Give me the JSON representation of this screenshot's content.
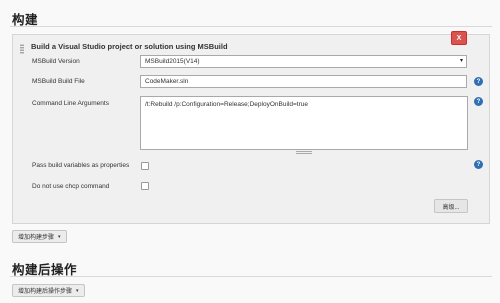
{
  "build_section": {
    "title": "构建"
  },
  "step": {
    "title": "Build a Visual Studio project or solution using MSBuild",
    "close_label": "X",
    "fields": {
      "msbuild_version": {
        "label": "MSBuild Version",
        "value": "MSBuild2015(V14)"
      },
      "build_file": {
        "label": "MSBuild Build File",
        "value": "CodeMaker.sln"
      },
      "command_args": {
        "label": "Command Line Arguments",
        "value": "/t:Rebuild /p:Configuration=Release;DeployOnBuild=true"
      },
      "pass_vars": {
        "label": "Pass build variables as properties",
        "checked": false
      },
      "no_chcp": {
        "label": "Do not use chcp command",
        "checked": false
      }
    },
    "advanced_label": "高级...",
    "help_glyph": "?"
  },
  "add_build_step": {
    "label": "增加构建步骤",
    "caret": "▾"
  },
  "post_build_section": {
    "title": "构建后操作"
  },
  "add_post_build_step": {
    "label": "增加构建后操作步骤",
    "caret": "▾"
  },
  "icons": {
    "select_arrow": "▾",
    "help": "help-icon",
    "close": "close-icon"
  },
  "colors": {
    "close_button": "#d9534f",
    "help_icon": "#2f6fb3"
  }
}
